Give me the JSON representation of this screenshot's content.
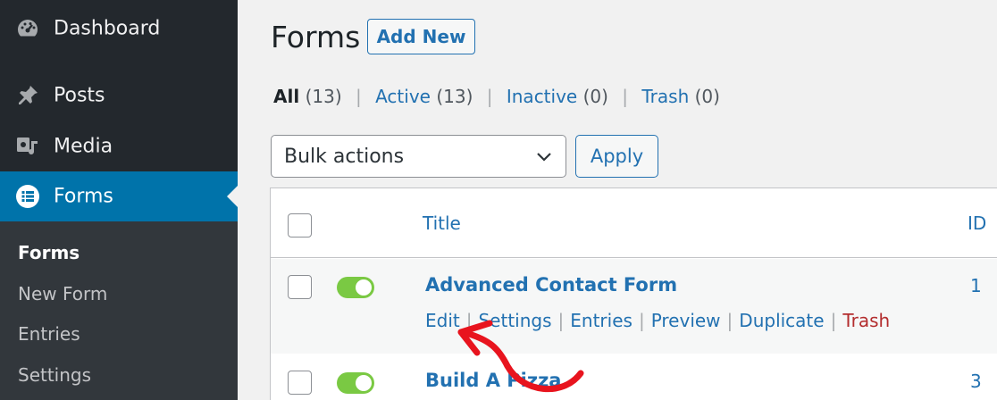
{
  "sidebar": {
    "menu": [
      {
        "label": "Dashboard",
        "icon": "dashboard-icon"
      },
      {
        "label": "Posts",
        "icon": "pin-icon"
      },
      {
        "label": "Media",
        "icon": "media-icon"
      },
      {
        "label": "Forms",
        "icon": "forms-icon",
        "active": true
      }
    ],
    "submenu": [
      {
        "label": "Forms",
        "current": true
      },
      {
        "label": "New Form"
      },
      {
        "label": "Entries"
      },
      {
        "label": "Settings"
      }
    ]
  },
  "header": {
    "title": "Forms",
    "add_new_label": "Add New"
  },
  "filters": {
    "all": {
      "label": "All",
      "count": "(13)"
    },
    "active": {
      "label": "Active",
      "count": "(13)"
    },
    "inactive": {
      "label": "Inactive",
      "count": "(0)"
    },
    "trash": {
      "label": "Trash",
      "count": "(0)"
    },
    "separator": "|"
  },
  "bulk": {
    "selected": "Bulk actions",
    "apply_label": "Apply"
  },
  "table": {
    "columns": {
      "title": "Title",
      "id": "ID"
    },
    "rows": [
      {
        "title": "Advanced Contact Form",
        "id": "1",
        "enabled": true
      },
      {
        "title": "Build A Pizza",
        "id": "3",
        "enabled": true
      }
    ],
    "row_actions": {
      "edit": "Edit",
      "settings": "Settings",
      "entries": "Entries",
      "preview": "Preview",
      "duplicate": "Duplicate",
      "trash": "Trash"
    }
  },
  "colors": {
    "sidebar": "#23282d",
    "submenu": "#32373c",
    "accent": "#0073aa",
    "link": "#2271b1",
    "toggle_on": "#7ac943",
    "trash": "#b32d2e",
    "annotation_arrow": "#e8141e"
  }
}
